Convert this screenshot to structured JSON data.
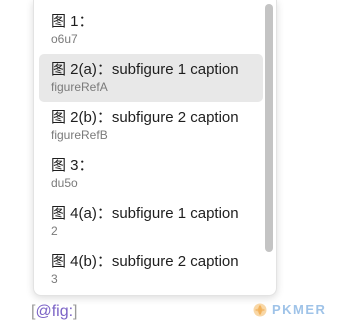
{
  "suggestions": [
    {
      "label": "图 1：",
      "sub": "o6u7",
      "selected": false
    },
    {
      "label": "图 2(a)：subfigure 1 caption",
      "sub": "figureRefA",
      "selected": true
    },
    {
      "label": "图 2(b)：subfigure 2 caption",
      "sub": "figureRefB",
      "selected": false
    },
    {
      "label": "图 3：",
      "sub": "du5o",
      "selected": false
    },
    {
      "label": "图 4(a)：subfigure 1 caption",
      "sub": "2",
      "selected": false
    },
    {
      "label": "图 4(b)：subfigure 2 caption",
      "sub": "3",
      "selected": false
    }
  ],
  "editor": {
    "open_bracket": "[",
    "query": "@fig:",
    "close_bracket": "]"
  },
  "watermark": {
    "text": "PKMER",
    "logo_icon": "pkmer-logo-icon"
  },
  "colors": {
    "selected_bg": "#e8e8e8",
    "query_color": "#7b63c6",
    "watermark_color": "#9fc3e8",
    "watermark_logo_color": "#f2b25c"
  }
}
